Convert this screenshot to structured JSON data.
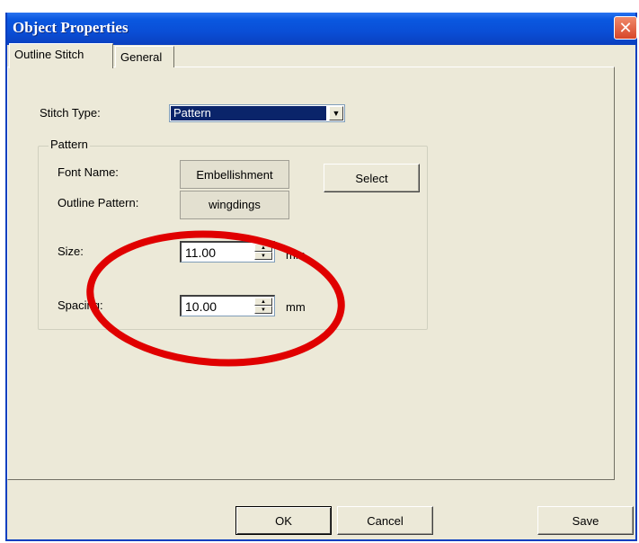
{
  "window": {
    "title": "Object Properties",
    "close_glyph": "✕"
  },
  "tabs": [
    {
      "label": "Outline Stitch",
      "active": true
    },
    {
      "label": "General",
      "active": false
    }
  ],
  "stitch_type": {
    "label": "Stitch Type:",
    "value": "Pattern",
    "arrow": "▼"
  },
  "pattern": {
    "group_label": "Pattern",
    "font_name_label": "Font Name:",
    "font_name_value": "Embellishment",
    "select_label": "Select",
    "outline_pattern_label": "Outline Pattern:",
    "outline_pattern_value": "wingdings",
    "size_label": "Size:",
    "size_value": "11.00",
    "size_unit": "mm",
    "spacing_label": "Spacing:",
    "spacing_value": "10.00",
    "spacing_unit": "mm"
  },
  "buttons": {
    "ok": "OK",
    "cancel": "Cancel",
    "save": "Save"
  },
  "annotation": {
    "color": "#e00000"
  }
}
